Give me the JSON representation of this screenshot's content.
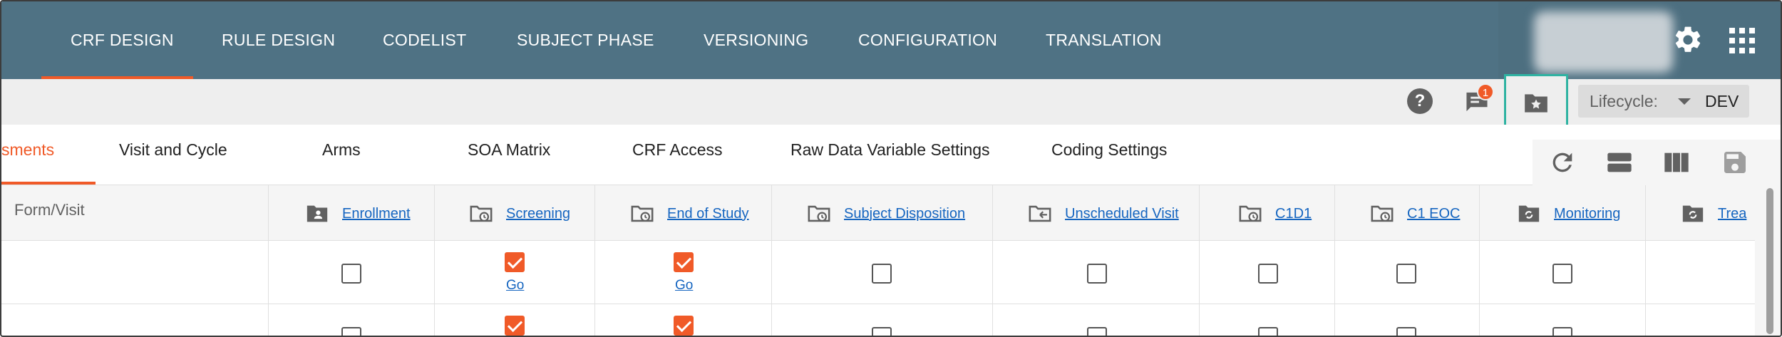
{
  "nav": {
    "tabs": [
      "CRF DESIGN",
      "RULE DESIGN",
      "CODELIST",
      "SUBJECT PHASE",
      "VERSIONING",
      "CONFIGURATION",
      "TRANSLATION"
    ],
    "active_tab": "CRF DESIGN"
  },
  "header_icons": [
    "gear-icon",
    "apps-grid-icon"
  ],
  "toolbar": {
    "help_icon": "?",
    "notification_count": "1",
    "lifecycle_label": "Lifecycle:",
    "lifecycle_value": "DEV"
  },
  "subtabs": {
    "items": [
      "sments",
      "Visit and Cycle",
      "Arms",
      "SOA Matrix",
      "CRF Access",
      "Raw Data Variable Settings",
      "Coding Settings"
    ],
    "active": "sments"
  },
  "table": {
    "row_header": "Form/Visit",
    "visits": [
      {
        "label": "Enrollment",
        "icon": "person-folder-icon"
      },
      {
        "label": "Screening",
        "icon": "clock-folder-icon"
      },
      {
        "label": "End of Study",
        "icon": "clock-folder-icon"
      },
      {
        "label": "Subject Disposition",
        "icon": "clock-folder-icon"
      },
      {
        "label": "Unscheduled Visit",
        "icon": "arrow-folder-icon"
      },
      {
        "label": "C1D1",
        "icon": "clock-folder-icon"
      },
      {
        "label": "C1 EOC",
        "icon": "clock-folder-icon"
      },
      {
        "label": "Monitoring",
        "icon": "cycle-folder-icon"
      },
      {
        "label": "Trea",
        "icon": "cycle-folder-icon"
      }
    ],
    "rows": [
      {
        "checked": [
          false,
          true,
          true,
          false,
          false,
          false,
          false,
          false
        ],
        "go": [
          "",
          "Go",
          "Go",
          "",
          "",
          "",
          "",
          ""
        ]
      },
      {
        "checked": [
          false,
          true,
          true,
          false,
          false,
          false,
          false,
          false
        ],
        "go": [
          "",
          "",
          "",
          "",
          "",
          "",
          "",
          ""
        ]
      }
    ]
  },
  "colors": {
    "nav_bg": "#4f7284",
    "accent": "#f05a28",
    "link": "#1565c0",
    "highlight": "#2fb3a2"
  }
}
